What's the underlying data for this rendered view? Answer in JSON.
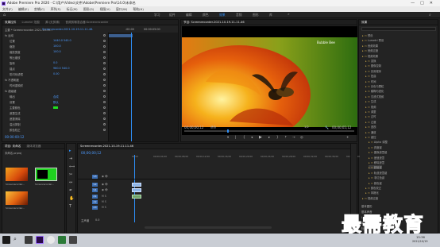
{
  "titlebar": {
    "title": "Adobe Premiere Pro 2020 - C:\\用户\\Video\\文件\\Adobe\\Premiere Pro\\14.0\\未命名"
  },
  "menu": [
    "文件(F)",
    "编辑(E)",
    "剪辑(C)",
    "序列(S)",
    "标记(M)",
    "图形(G)",
    "视图(V)",
    "窗口(W)",
    "帮助(H)"
  ],
  "workspaces": [
    "学习",
    "组件",
    "编辑",
    "颜色",
    "效果",
    "音频",
    "图形",
    "库"
  ],
  "active_workspace": "效果",
  "effect_controls": {
    "tabs": [
      "效果控件",
      "Lumetri 范围",
      "源:(无剪辑)",
      "音频剪辑混合器:Screenrecorder"
    ],
    "clip": "主要 * Screenrecorder-2021-10-19...",
    "sequence": "Screenrecorder-2021-10-19-11-11-46.",
    "timecode_start": ":00:00",
    "timecode_end": "00:00:05:00",
    "rows": [
      {
        "label": "fx 运动",
        "value": ""
      },
      {
        "label": "位置",
        "value": "1440.0   540.0"
      },
      {
        "label": "缩放",
        "value": "100.0"
      },
      {
        "label": "缩放宽度",
        "value": "100.0"
      },
      {
        "label": "等比缩放",
        "value": ""
      },
      {
        "label": "旋转",
        "value": "0.0"
      },
      {
        "label": "锚点",
        "value": "960.0   540.0"
      },
      {
        "label": "防闪烁滤镜",
        "value": "0.00"
      },
      {
        "label": "fx 不透明度",
        "value": ""
      },
      {
        "label": "时间重映射",
        "value": ""
      },
      {
        "label": "fx 超级键",
        "value": ""
      },
      {
        "label": "输出",
        "value": "合成"
      },
      {
        "label": "设置",
        "value": "默认"
      },
      {
        "label": "主要颜色",
        "value": ""
      },
      {
        "label": "遮罩生成",
        "value": ""
      },
      {
        "label": "遮罩清除",
        "value": ""
      },
      {
        "label": "溢出抑制",
        "value": ""
      },
      {
        "label": "颜色校正",
        "value": ""
      }
    ],
    "footer_time": "00:00:00:12"
  },
  "program": {
    "tab": "节目: Screenrecorder-2021-10-19-11-11-46",
    "current_time": "00;00;00;12",
    "fit": "适合",
    "zoom": "1/2",
    "duration": "00;00;05;12",
    "watermark_small": "Bubble Bee"
  },
  "effects_panel": {
    "title": "效果",
    "items": [
      "预设",
      "Lumetri 预设",
      "音频效果",
      "音频过渡",
      "视频效果",
      "变换",
      "图像控制",
      "实用程序",
      "扭曲",
      "时间",
      "杂色与颗粒",
      "模糊与锐化",
      "沉浸式视频",
      "生成",
      "视频",
      "调整",
      "过时",
      "过渡",
      "透视",
      "通道",
      "键控",
      "Alpha 调整",
      "亮度键",
      "图像遮罩键",
      "差值遮罩",
      "移除遮罩",
      "超级键",
      "轨道遮罩键",
      "非红色键",
      "颜色键",
      "颜色校正",
      "风格化",
      "视频过渡"
    ],
    "footer": [
      "基本图形",
      "基本声音",
      "Lumetri 颜色",
      "库",
      "标记"
    ]
  },
  "project": {
    "tabs": [
      "项目: 未命名",
      "媒体浏览器"
    ],
    "name": "未命名.prproj",
    "items": [
      "Screenrecorder...",
      "Screenrecorder...",
      "Screenrecorder..."
    ]
  },
  "timeline": {
    "tab": "Screenrecorder-2021-10-19-11-11-46",
    "timecode": "00;00;00;12",
    "ruler": [
      "00;00",
      "00;00;04;00",
      "00;00;08;00",
      "00;00;12;00",
      "00;00;16;00",
      "00;00;20;00",
      "00;00;24;00",
      "00;00;28;00",
      "00;00;32;00",
      "00;00;36;00",
      "00;00;40;00"
    ],
    "tracks": [
      "V3",
      "V2",
      "V1",
      "A1",
      "A2",
      "A3"
    ],
    "master": "主声道",
    "master_value": "0.0"
  },
  "taskbar": {
    "time": "15:36",
    "date": "2021/10/19"
  },
  "brand_watermark": "最需教育",
  "colors": {
    "accent": "#2e8ef6",
    "bg": "#1d1d1d",
    "panel": "#232323"
  }
}
